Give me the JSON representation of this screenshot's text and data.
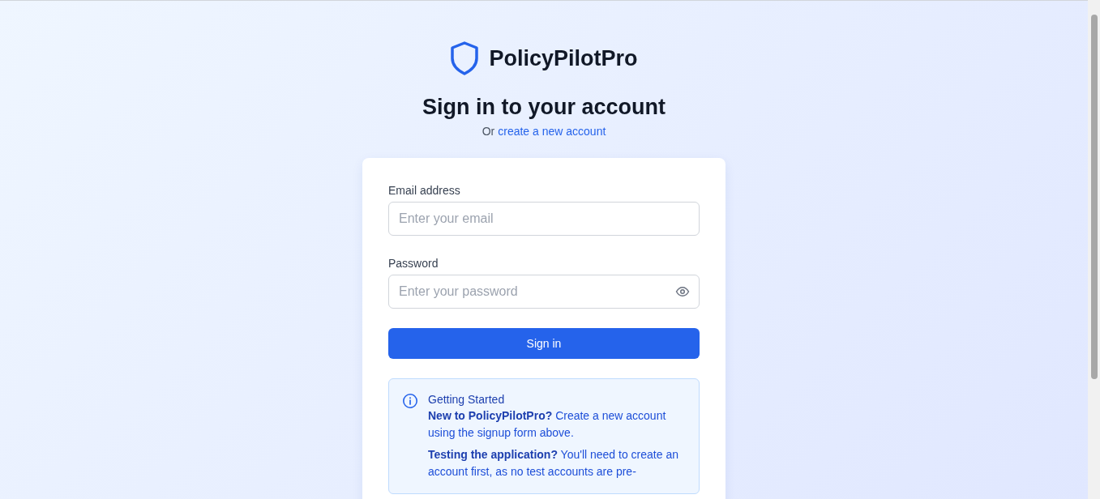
{
  "brand": {
    "name": "PolicyPilotPro"
  },
  "heading": {
    "title": "Sign in to your account",
    "prefix": "Or",
    "link": "create a new account"
  },
  "form": {
    "fields": [
      {
        "kind": "email",
        "label": "Email address",
        "placeholder": "Enter your email"
      },
      {
        "kind": "password",
        "label": "Password",
        "placeholder": "Enter your password"
      }
    ],
    "submit": "Sign in"
  },
  "notice": {
    "title": "Getting Started",
    "paragraphs": [
      "**New to PolicyPilotPro?** Create a new account using the signup form above.",
      "**Testing the application?** You'll need to create an account first, as no test accounts are pre-"
    ]
  }
}
